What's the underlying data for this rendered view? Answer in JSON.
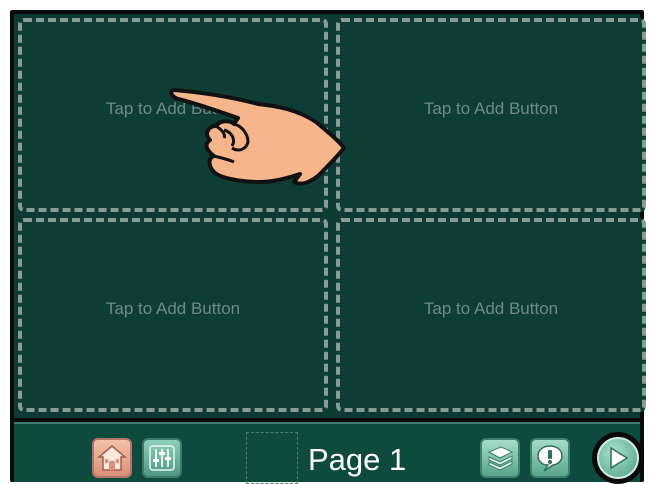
{
  "board": {
    "cells": [
      {
        "label": "Tap to Add Button"
      },
      {
        "label": "Tap to Add Button"
      },
      {
        "label": "Tap to Add Button"
      },
      {
        "label": "Tap to Add Button"
      }
    ]
  },
  "toolbar": {
    "page_label": "Page 1",
    "icons": {
      "home": "home-icon",
      "settings": "sliders-icon",
      "pages": "page-stack-icon",
      "alert": "speech-alert-icon",
      "play": "play-icon"
    }
  },
  "colors": {
    "board_bg": "#0c3a32",
    "toolbar_bg": "#0f4a3f",
    "cell_border": "#8a9a95",
    "cell_text": "#6e8a83",
    "home_accent": "#d9907a",
    "button_accent": "#5aa58c"
  },
  "overlay": {
    "pointer": "pointing-hand-icon"
  }
}
